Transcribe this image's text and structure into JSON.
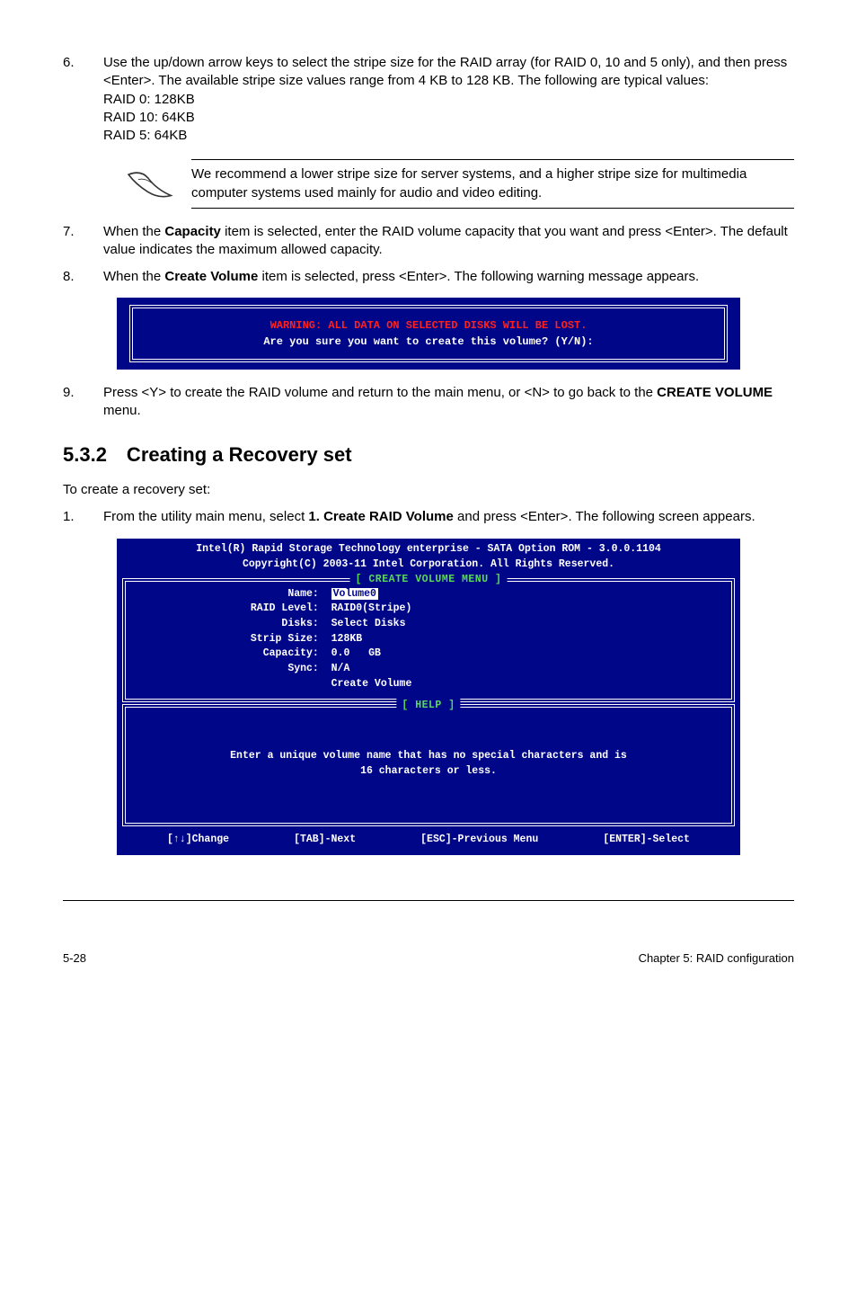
{
  "step6": {
    "num": "6.",
    "text1": "Use the up/down arrow keys to select the stripe size for the RAID array (for RAID 0, 10 and 5 only), and then press <Enter>. The available stripe size values range from 4 KB to 128 KB. The following are typical values:",
    "l1": "RAID 0: 128KB",
    "l2": "RAID 10: 64KB",
    "l3": "RAID 5: 64KB"
  },
  "note": "We recommend a lower stripe size for server systems, and a higher stripe size for multimedia computer systems used mainly for audio and video editing.",
  "step7": {
    "num": "7.",
    "pre": "When the ",
    "bold": "Capacity",
    "post": " item is selected, enter the RAID volume capacity that you want and press <Enter>. The default value indicates the maximum allowed capacity."
  },
  "step8": {
    "num": "8.",
    "pre": "When the ",
    "bold": "Create Volume",
    "post": " item is selected, press <Enter>. The following warning message appears."
  },
  "warning": {
    "line1": "WARNING: ALL DATA ON SELECTED DISKS WILL BE LOST.",
    "line2": "Are you sure you want to create this volume? (Y/N):"
  },
  "step9": {
    "num": "9.",
    "pre": "Press <Y> to create the RAID volume and return to the main menu, or <N> to go back to the ",
    "bold": "CREATE VOLUME",
    "post": " menu."
  },
  "section_title": "5.3.2 Creating a Recovery set",
  "intro": "To create a recovery set:",
  "step1": {
    "num": "1.",
    "pre": "From the utility main menu, select ",
    "bold": "1. Create RAID Volume",
    "post": " and press <Enter>. The following screen appears."
  },
  "bios": {
    "header1": "Intel(R) Rapid Storage Technology enterprise - SATA Option ROM - 3.0.0.1104",
    "header2": "Copyright(C) 2003-11 Intel Corporation.  All Rights Reserved.",
    "panel1_title": "[ CREATE VOLUME MENU ]",
    "kv": {
      "name_label": "Name:",
      "name_val": "Volume0",
      "raid_label": "RAID Level:",
      "raid_val": "RAID0(Stripe)",
      "disks_label": "Disks:",
      "disks_val": "Select Disks",
      "strip_label": "Strip Size:",
      "strip_val": "128KB",
      "cap_label": "Capacity:",
      "cap_val": "0.0   GB",
      "sync_label": "Sync:",
      "sync_val": "N/A",
      "create": "Create Volume"
    },
    "panel2_title": "[ HELP ]",
    "help1": "Enter a unique volume name that has no special characters and is",
    "help2": "16 characters or less.",
    "nav1": "[↑↓]Change",
    "nav2": "[TAB]-Next",
    "nav3": "[ESC]-Previous Menu",
    "nav4": "[ENTER]-Select"
  },
  "footer": {
    "left": "5-28",
    "right": "Chapter 5: RAID configuration"
  }
}
